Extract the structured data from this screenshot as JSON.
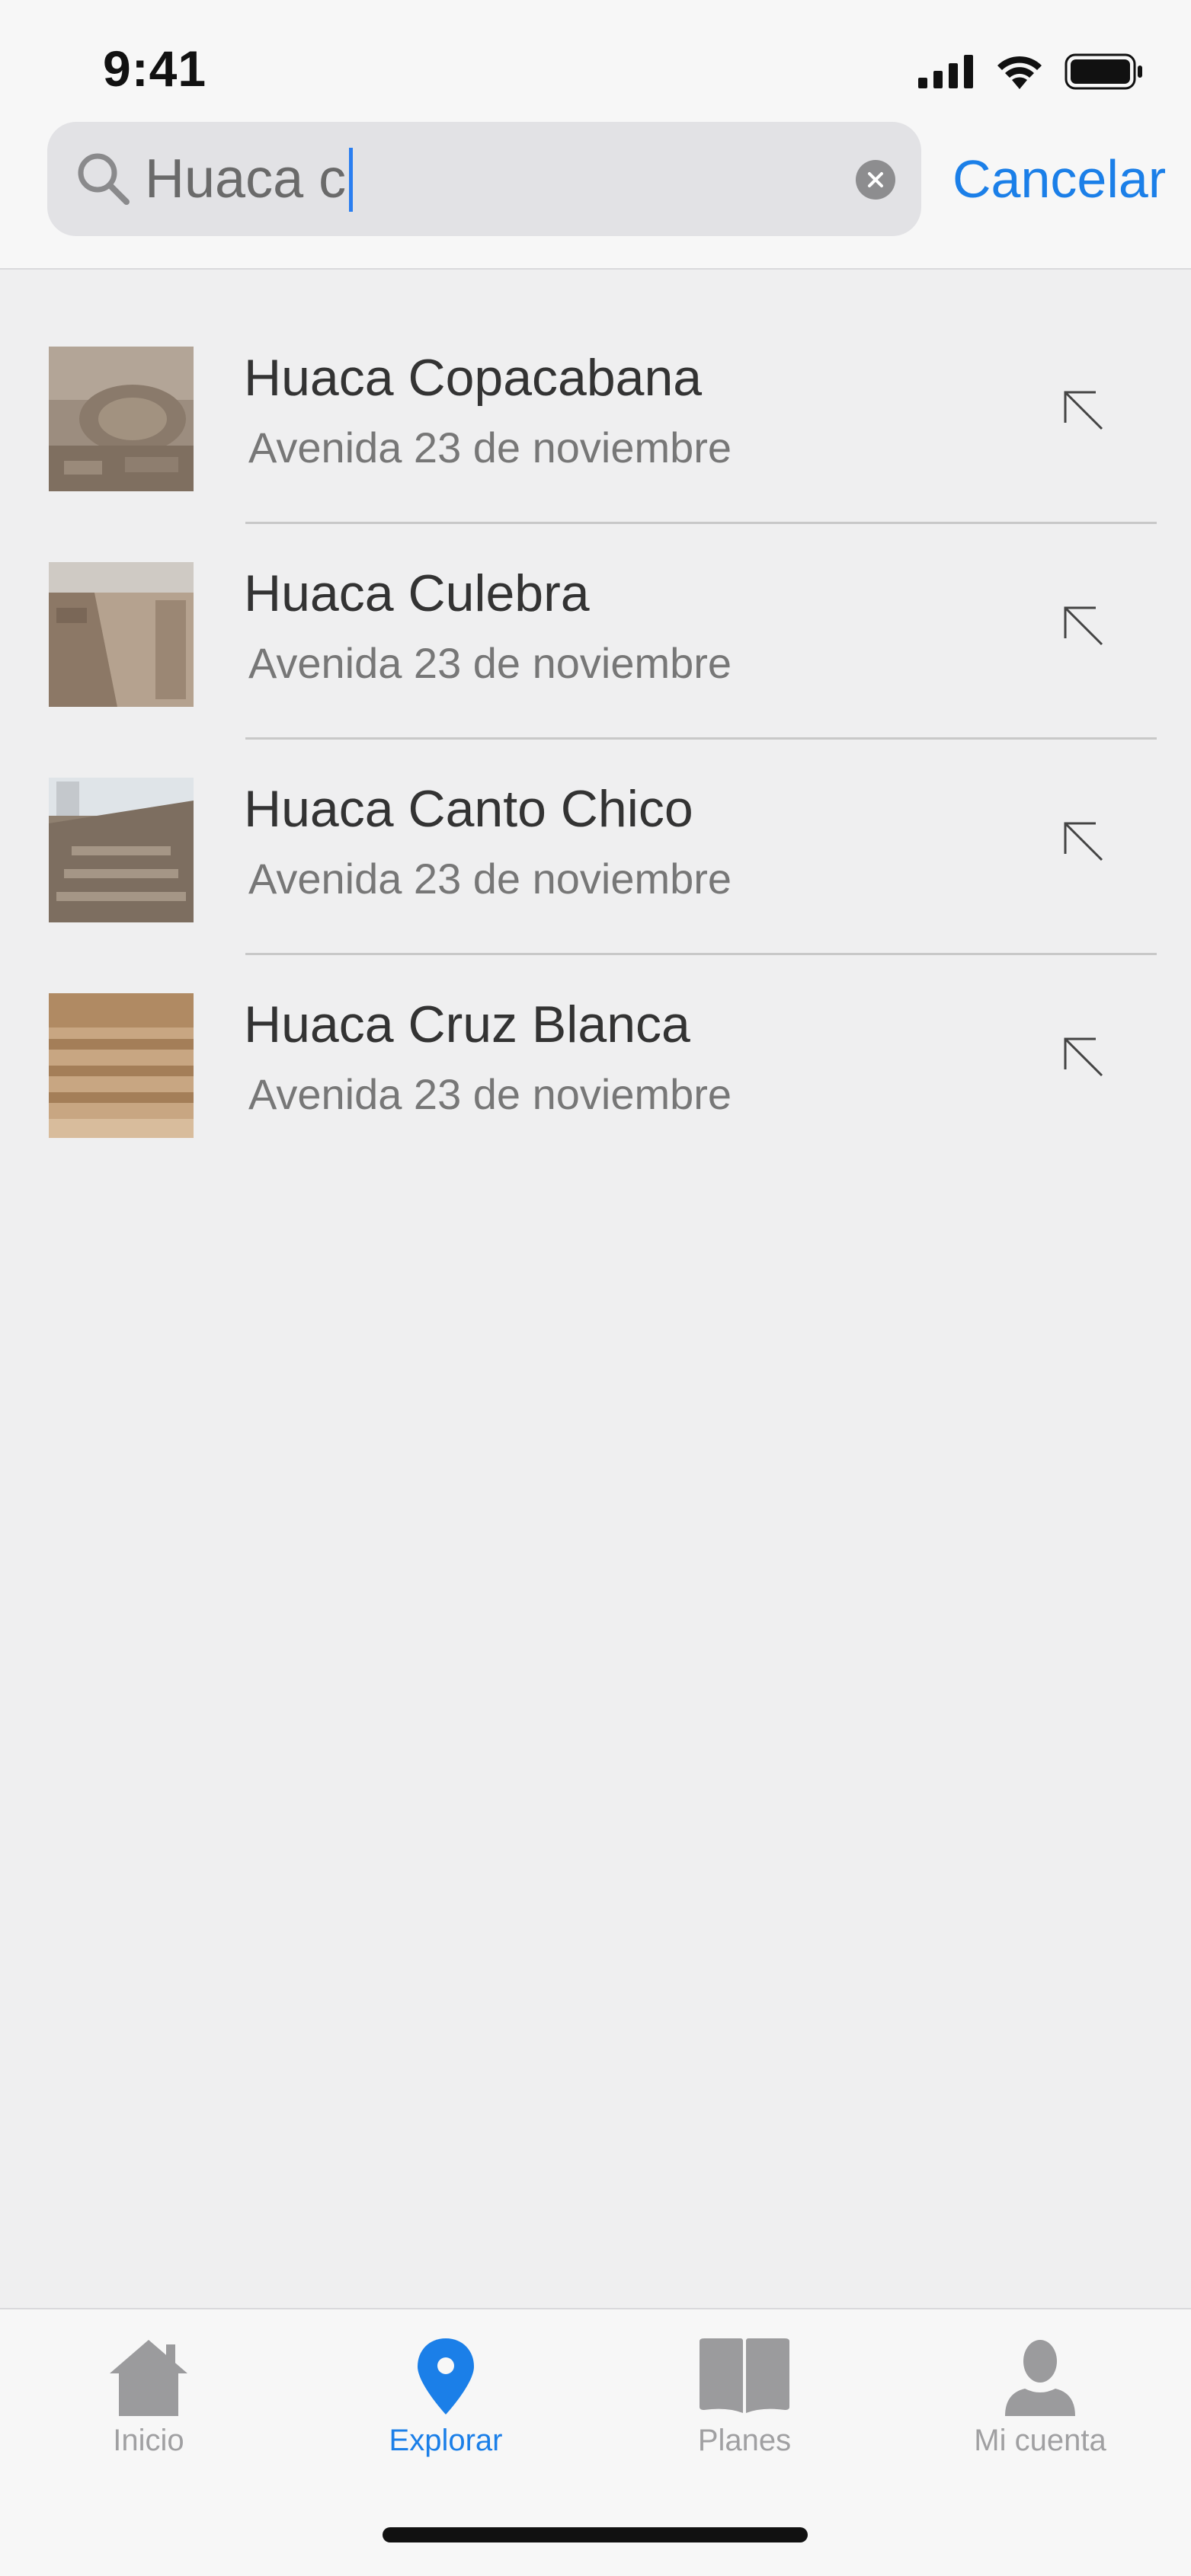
{
  "status_bar": {
    "time": "9:41"
  },
  "search": {
    "query": "Huaca c",
    "cancel_label": "Cancelar"
  },
  "results": [
    {
      "title": "Huaca Copacabana",
      "subtitle": "Avenida 23 de noviembre"
    },
    {
      "title": "Huaca Culebra",
      "subtitle": "Avenida 23 de noviembre"
    },
    {
      "title": "Huaca Canto Chico",
      "subtitle": "Avenida 23 de noviembre"
    },
    {
      "title": "Huaca Cruz Blanca",
      "subtitle": "Avenida 23 de noviembre"
    }
  ],
  "tabbar": {
    "tabs": [
      {
        "label": "Inicio",
        "icon": "home-icon",
        "active": false
      },
      {
        "label": "Explorar",
        "icon": "location-pin-icon",
        "active": true
      },
      {
        "label": "Planes",
        "icon": "book-icon",
        "active": false
      },
      {
        "label": "Mi cuenta",
        "icon": "person-icon",
        "active": false
      }
    ]
  },
  "colors": {
    "accent": "#1b7fe8",
    "inactive": "#a0a0a2",
    "background": "#efeff0"
  }
}
